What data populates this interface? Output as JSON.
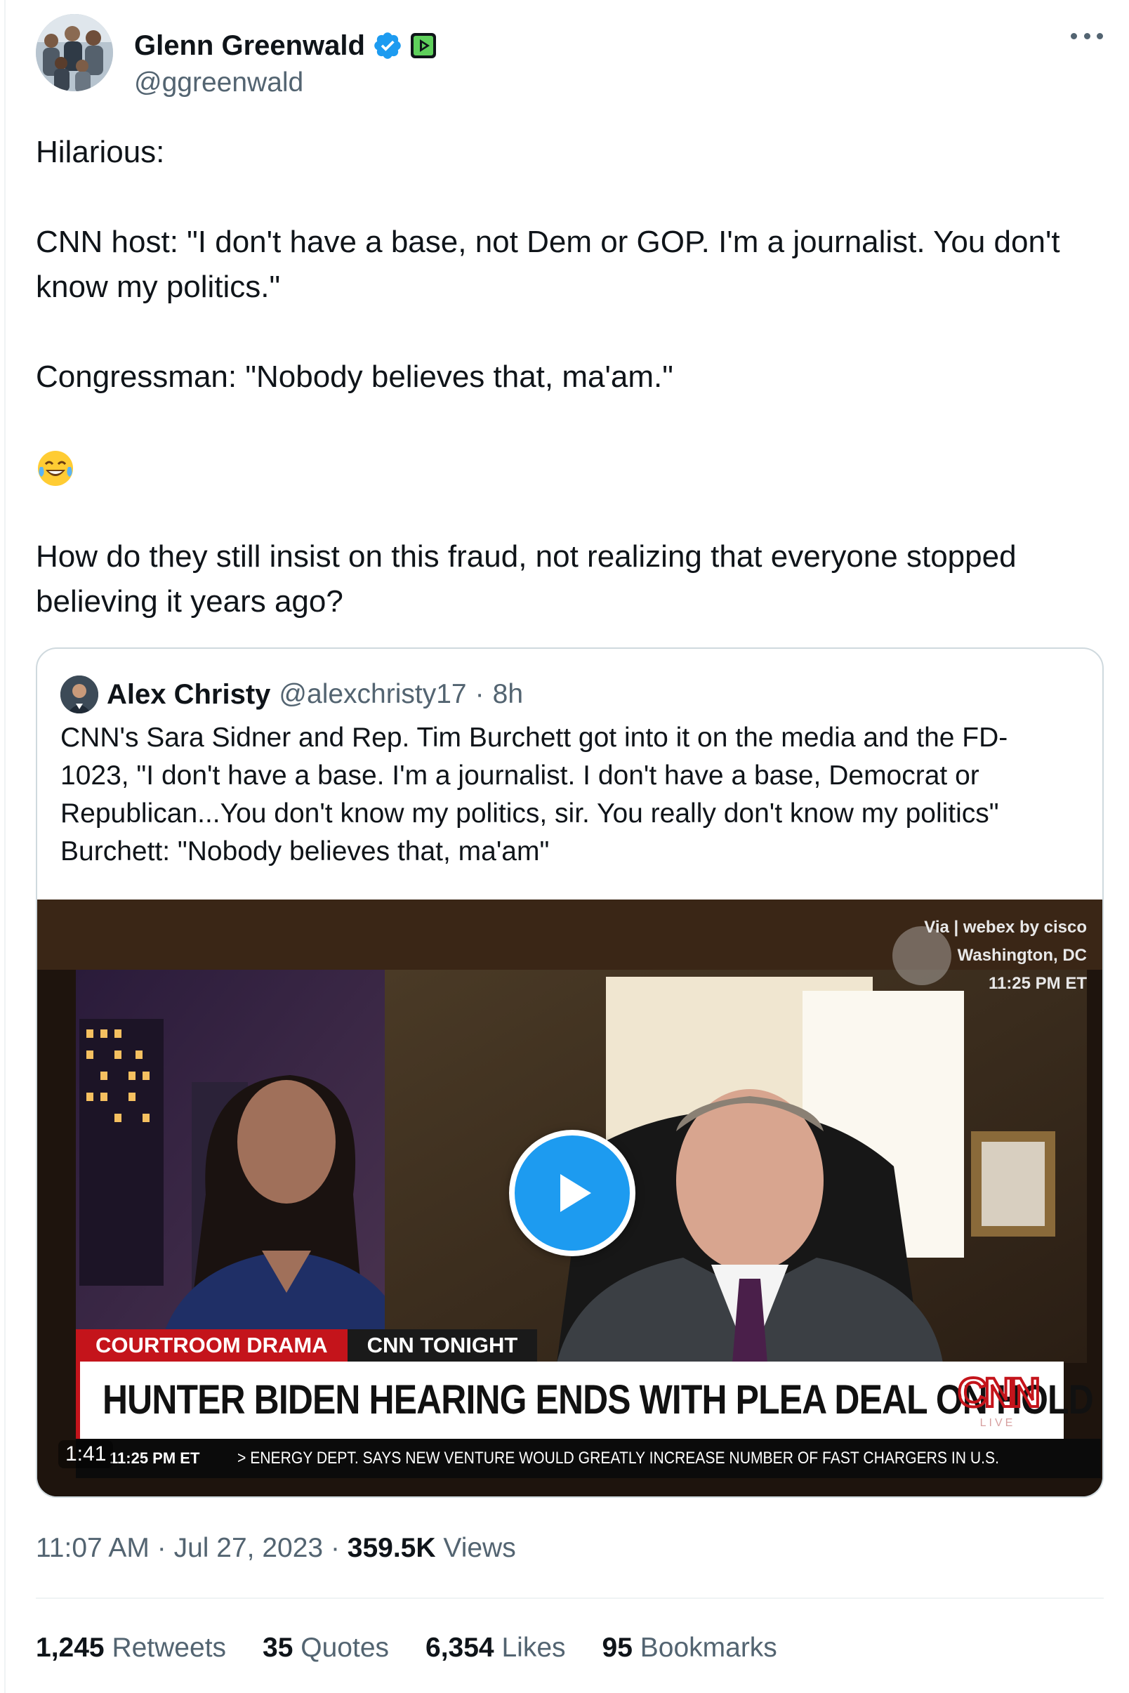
{
  "author": {
    "name": "Glenn Greenwald",
    "handle": "@ggreenwald",
    "verified": true
  },
  "tweet": {
    "lines": [
      "Hilarious:",
      "",
      "CNN host: \"I don't have a base, not Dem or GOP. I'm a journalist. You don't",
      "know my politics.\"",
      "",
      "Congressman:  \"Nobody believes that, ma'am.\"",
      "",
      "",
      "",
      "How do they still insist on this fraud, not realizing that everyone stopped",
      "believing it years ago?"
    ],
    "emoji": "face-with-tears-of-joy"
  },
  "quote": {
    "name": "Alex Christy",
    "handle": "@alexchristy17",
    "separator": "·",
    "time": "8h",
    "lines": [
      "CNN's Sara Sidner and Rep. Tim Burchett got into it on the media and the FD-",
      "1023, \"I don't have a base. I'm a journalist. I don't have a base, Democrat or",
      "Republican...You don't know my politics, sir. You really don't know my politics\"",
      "Burchett: \"Nobody believes that, ma'am\""
    ],
    "video": {
      "duration": "1:41",
      "overlay": {
        "via": "Via | webex by cisco",
        "location": "Washington, DC",
        "time": "11:25 PM ET"
      },
      "chyron": {
        "tag_left": "COURTROOM DRAMA",
        "tag_right": "CNN TONIGHT",
        "headline": "HUNTER BIDEN HEARING ENDS WITH PLEA DEAL ON HOLD",
        "logo": "CNN",
        "logo_sub": "LIVE",
        "ticker_time": "11:25 PM ET",
        "ticker_text": "> ENERGY DEPT. SAYS NEW VENTURE WOULD GREATLY INCREASE NUMBER OF FAST CHARGERS IN U.S."
      }
    }
  },
  "meta": {
    "time": "11:07 AM",
    "separator": "·",
    "date": "Jul 27, 2023",
    "views_count": "359.5K",
    "views_label": "Views"
  },
  "stats": [
    {
      "count": "1,245",
      "label": "Retweets"
    },
    {
      "count": "35",
      "label": "Quotes"
    },
    {
      "count": "6,354",
      "label": "Likes"
    },
    {
      "count": "95",
      "label": "Bookmarks"
    }
  ],
  "colors": {
    "text": "#0f1419",
    "secondary": "#536471",
    "accent": "#1d9bf0",
    "border": "#cfd9de",
    "cnn_red": "#c4141b"
  }
}
